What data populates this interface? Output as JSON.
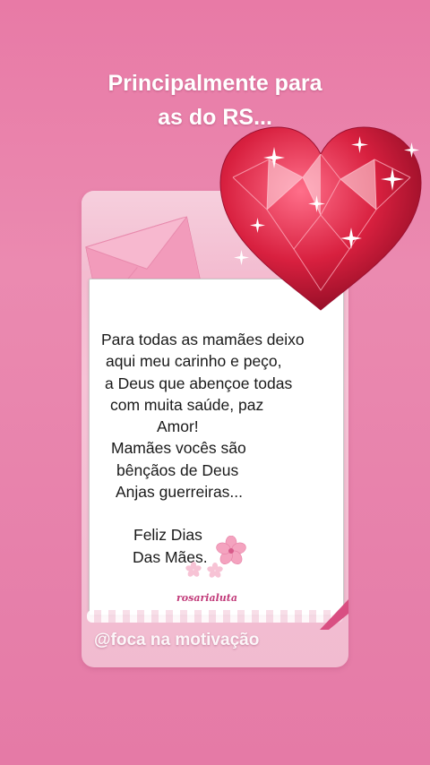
{
  "caption": {
    "line1": "Principalmente para",
    "line2": "as do RS..."
  },
  "card": {
    "message_lines": [
      "Para todas as mamães deixo",
      "aqui meu carinho e peço,",
      "a Deus que abençoe todas",
      "com muita saúde, paz",
      "Amor!",
      "Mamães vocês são",
      "bênçãos de Deus",
      "Anjas guerreiras...",
      "",
      "Feliz Dias",
      "Das Mães."
    ],
    "signature": "rosarialuta",
    "watermark": "@foca na motivação"
  },
  "icons": {
    "heart": "diamond-heart-icon",
    "envelope": "envelope-icon",
    "flower": "cherry-blossom-icon"
  },
  "colors": {
    "background": "#e985ad",
    "heart_red": "#d8203f",
    "paper": "#ffffff",
    "text": "#1a1a1a"
  }
}
